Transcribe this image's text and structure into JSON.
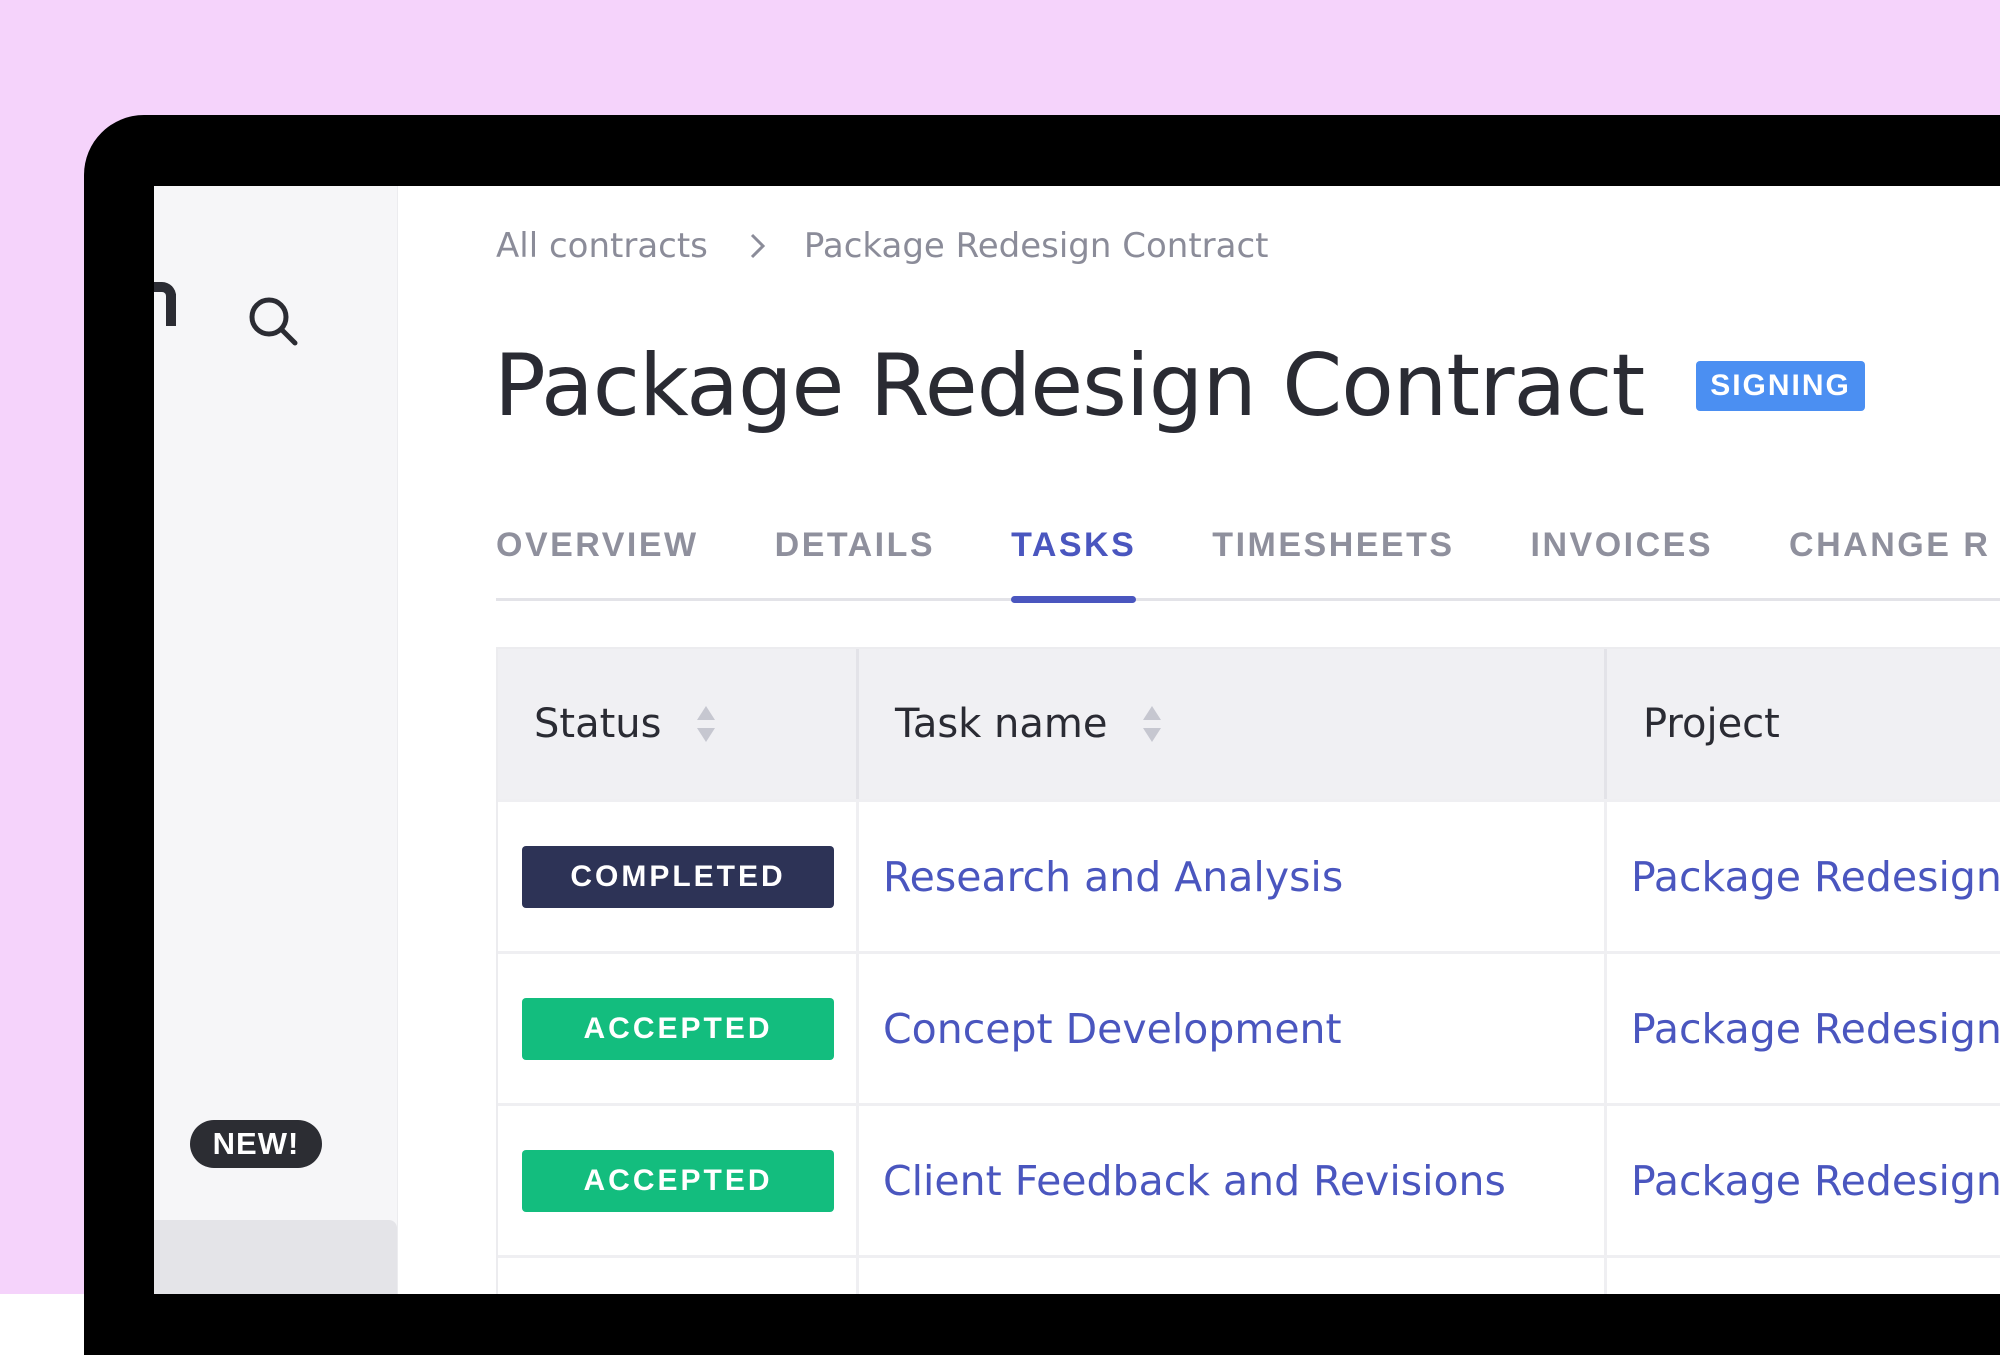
{
  "colors": {
    "backdrop": "#f5d3fb",
    "accent": "#4a56bf",
    "signing": "#4b8ff2",
    "completed": "#2d3356",
    "accepted": "#13bd7e",
    "in_progress": "#4b8ff2"
  },
  "sidebar": {
    "search_icon": "search-icon",
    "new_badge": "NEW!"
  },
  "breadcrumb": {
    "root": "All contracts",
    "separator_icon": "chevron-right-icon",
    "current": "Package Redesign Contract"
  },
  "contract": {
    "title": "Package Redesign Contract",
    "status": "SIGNING"
  },
  "tabs": [
    {
      "label": "OVERVIEW",
      "active": false
    },
    {
      "label": "DETAILS",
      "active": false
    },
    {
      "label": "TASKS",
      "active": true
    },
    {
      "label": "TIMESHEETS",
      "active": false
    },
    {
      "label": "INVOICES",
      "active": false
    },
    {
      "label": "CHANGE R",
      "active": false
    }
  ],
  "table": {
    "columns": {
      "status": "Status",
      "task": "Task name",
      "project": "Project"
    },
    "rows": [
      {
        "status": "COMPLETED",
        "status_kind": "completed",
        "task": "Research and Analysis",
        "project": "Package Redesign"
      },
      {
        "status": "ACCEPTED",
        "status_kind": "accepted",
        "task": "Concept Development",
        "project": "Package Redesign"
      },
      {
        "status": "ACCEPTED",
        "status_kind": "accepted",
        "task": "Client Feedback and Revisions",
        "project": "Package Redesign"
      }
    ]
  }
}
